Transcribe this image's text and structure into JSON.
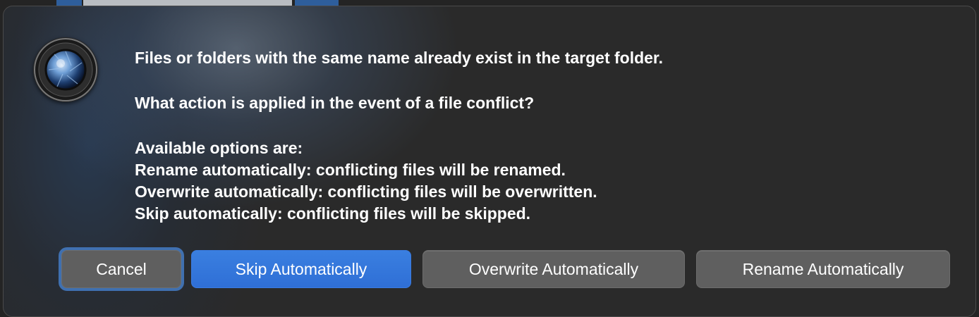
{
  "message": {
    "line1": "Files or folders with the same name already exist in the target folder.",
    "line2": "What action is applied in the event of a file conflict?",
    "line3": "Available options are:",
    "line4": "Rename automatically: conflicting files will be renamed.",
    "line5": "Overwrite automatically: conflicting files will be overwritten.",
    "line6": "Skip automatically: conflicting files will be skipped."
  },
  "buttons": {
    "cancel": "Cancel",
    "skip": "Skip Automatically",
    "overwrite": "Overwrite Automatically",
    "rename": "Rename Automatically"
  },
  "icon": {
    "name": "digikam-app-icon",
    "ring_text": "f=6.0mm digiKam powered by Open Source www.digikam.org 1:2.8"
  },
  "colors": {
    "primary_button": "#2f6fd6",
    "gray_button": "#5f5f5f",
    "focus_ring": "#4278be",
    "dialog_background": "#2a2a2a",
    "text": "#ffffff"
  }
}
